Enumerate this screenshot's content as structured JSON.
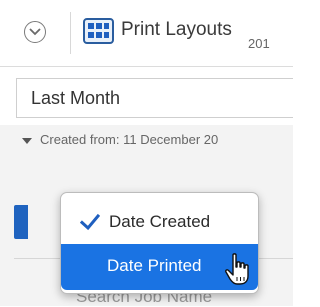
{
  "toolbar": {
    "title": "Print Layouts",
    "icons": [
      "chevron-down-circle-icon",
      "print-layouts-grid-icon"
    ]
  },
  "range": {
    "value": "Last Month"
  },
  "filter": {
    "created_from_text": "Created from: 11 December 20",
    "overflow_text": "201"
  },
  "search": {
    "placeholder_text": "Search Job Name"
  },
  "sort_menu": {
    "items": [
      {
        "label": "Date Created",
        "checked": true,
        "highlighted": false
      },
      {
        "label": "Date Printed",
        "checked": false,
        "highlighted": true
      }
    ]
  },
  "colors": {
    "accent": "#1a73e3",
    "check": "#1f5fbf",
    "background": "#ffffff",
    "panel": "#f3f3f3"
  }
}
